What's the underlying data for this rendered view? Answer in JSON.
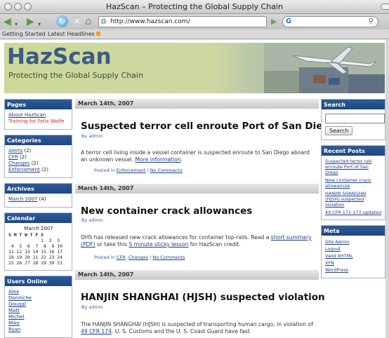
{
  "window": {
    "title": "HazScan – Protecting the Global Supply Chain"
  },
  "browser": {
    "url": "http://www.hazscan.com/",
    "search_engine": "G",
    "bookmarks": [
      "Getting Started",
      "Latest Headlines"
    ]
  },
  "site": {
    "name": "HazScan",
    "tagline": "Protecting the Global Supply Chain"
  },
  "left_sidebar": {
    "pages": {
      "heading": "Pages",
      "items": [
        "About HazScan",
        "Training for Felix Wolfe"
      ]
    },
    "categories": {
      "heading": "Categories",
      "items": [
        "Alerts",
        "CFR",
        "Changes",
        "Enforcement"
      ],
      "counts": [
        "(2)",
        "(2)",
        "(2)",
        "(2)"
      ]
    },
    "archives": {
      "heading": "Archives",
      "items": [
        "March 2007"
      ],
      "counts": [
        "(4)"
      ]
    },
    "calendar": {
      "heading": "Calendar",
      "month": "March 2007",
      "days_header": "S M T W T F S",
      "rows": [
        "            1  2  3",
        " 4  5  6  7  8  9 10",
        "11 12 13 14 15 16 17",
        "18 19 20 21 22 23 24",
        "25 26 27 28 29 30 31"
      ]
    },
    "users_online": {
      "heading": "Users Online",
      "items": [
        "Alex",
        "Donniche",
        "Dougal",
        "Matt",
        "Michel",
        "Mike",
        "Ryan"
      ]
    }
  },
  "right_sidebar": {
    "search": {
      "heading": "Search",
      "button": "Search"
    },
    "recent_posts": {
      "heading": "Recent Posts",
      "items": [
        "Suspected terror cell enroute Port of San Diego",
        "New container crack allowances",
        "HANJIN SHANGHAI (HJSH) suspected violation",
        "49 CFR 171-173 updated"
      ]
    },
    "meta": {
      "heading": "Meta",
      "items": [
        "Site Admin",
        "Logout",
        "Valid XHTML",
        "XFN",
        "WordPress"
      ]
    }
  },
  "posts": [
    {
      "date": "March 14th, 2007",
      "title": "Suspected terror cell enroute Port of San Diego",
      "by": "By admin",
      "body": "A terror cell living inside a vessel container is suspected enroute to San Diego aboard an unknown vessel.",
      "body_link": "More information",
      "posted_in": "Posted in",
      "category": "Enforcement",
      "comments": "No Comments"
    },
    {
      "date": "March 14th, 2007",
      "title": "New container crack allowances",
      "by": "By admin",
      "body_a": "DHS has released new crack allowances for container top-rails. Read a",
      "link_a": "short summary (PDF)",
      "body_b": "or take this",
      "link_b": "5 minute sticky lesson",
      "body_c": "for HazScan credit.",
      "posted_in": "Posted in",
      "category": "CFR",
      "category2": "Changes",
      "comments": "No Comments"
    },
    {
      "date": "March 14th, 2007",
      "title": "HANJIN SHANGHAI (HJSH) suspected violation",
      "by": "By admin",
      "body_a": "The HANJIN SHANGHAI (HJSH) is suspected of transporting human cargo, in violation of",
      "link_a": "49 CFR 174",
      "body_b": ". U. S. Customs and the U. S. Coast Guard have fast"
    }
  ]
}
